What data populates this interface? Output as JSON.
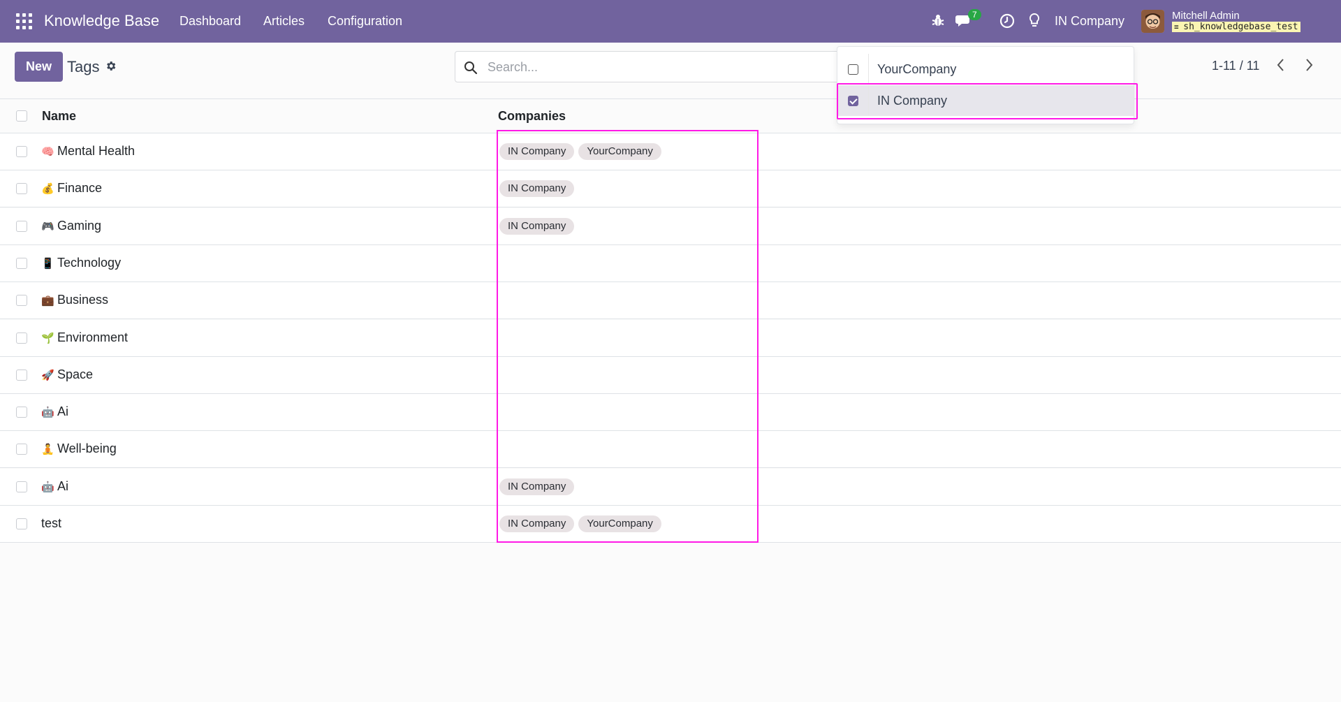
{
  "navbar": {
    "app_name": "Knowledge Base",
    "menu": [
      "Dashboard",
      "Articles",
      "Configuration"
    ],
    "messages_count": "7",
    "company": "IN Company",
    "user_name": "Mitchell Admin",
    "db_name": "sh_knowledgebase_test",
    "icons": [
      "apps-icon",
      "bug-icon",
      "chat-icon",
      "clock-icon",
      "lightbulb-icon"
    ],
    "accent_color": "#71639e"
  },
  "control_panel": {
    "new_button": "New",
    "title": "Tags",
    "search_placeholder": "Search...",
    "pager": "1-11 / 11"
  },
  "company_dropdown": {
    "items": [
      {
        "label": "YourCompany",
        "checked": false
      },
      {
        "label": "IN Company",
        "checked": true
      }
    ]
  },
  "table": {
    "columns": [
      "Name",
      "Companies"
    ],
    "rows": [
      {
        "emoji": "🧠",
        "name": "Mental Health",
        "companies": [
          "IN Company",
          "YourCompany"
        ]
      },
      {
        "emoji": "💰",
        "name": "Finance",
        "companies": [
          "IN Company"
        ]
      },
      {
        "emoji": "🎮",
        "name": "Gaming",
        "companies": [
          "IN Company"
        ]
      },
      {
        "emoji": "📱",
        "name": "Technology",
        "companies": []
      },
      {
        "emoji": "💼",
        "name": "Business",
        "companies": []
      },
      {
        "emoji": "🌱",
        "name": "Environment",
        "companies": []
      },
      {
        "emoji": "🚀",
        "name": "Space",
        "companies": []
      },
      {
        "emoji": "🤖",
        "name": "Ai",
        "companies": []
      },
      {
        "emoji": "🧘",
        "name": "Well-being",
        "companies": []
      },
      {
        "emoji": "🤖",
        "name": "Ai",
        "companies": [
          "IN Company"
        ]
      },
      {
        "emoji": "",
        "name": "test",
        "companies": [
          "IN Company",
          "YourCompany"
        ]
      }
    ]
  },
  "highlight_color": "#ff19e6"
}
